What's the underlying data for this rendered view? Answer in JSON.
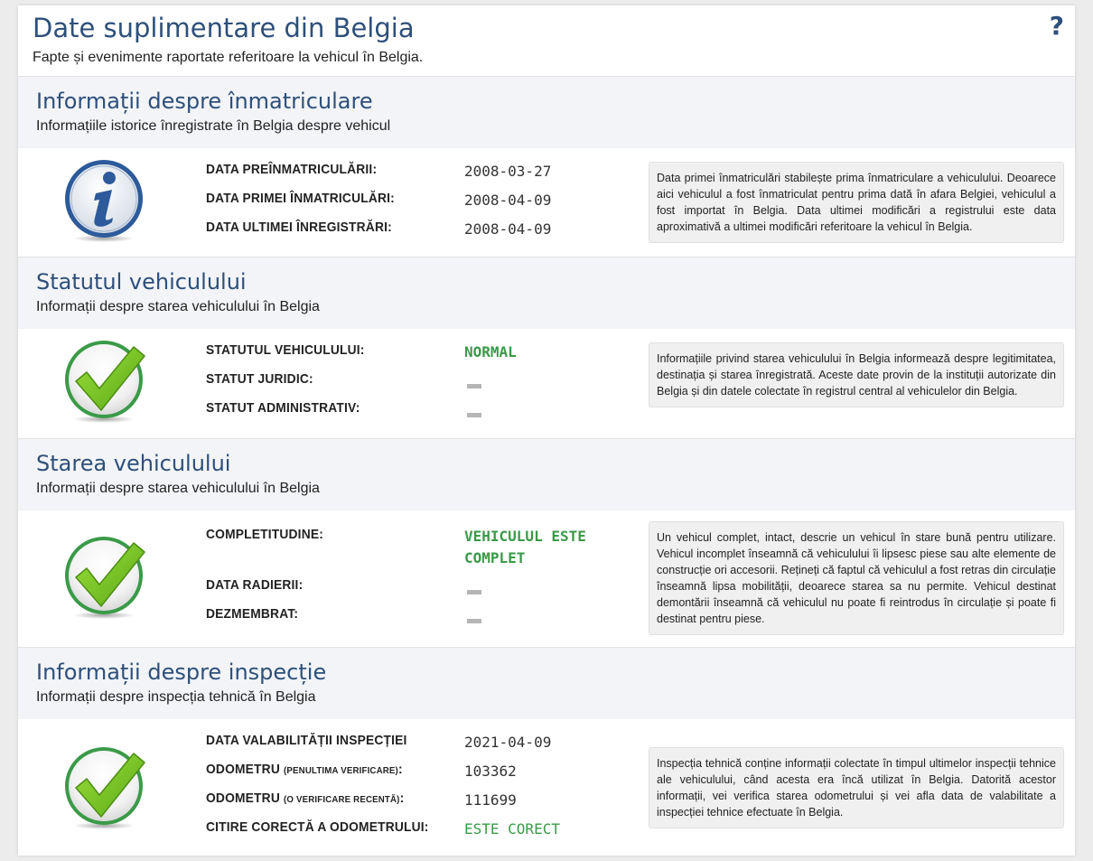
{
  "page": {
    "title": "Date suplimentare din Belgia",
    "subtitle": "Fapte și evenimente raportate referitoare la vehicul în Belgia.",
    "help_icon": "question-mark-icon",
    "help_label": "?"
  },
  "sections": {
    "registration": {
      "title": "Informații despre înmatriculare",
      "subtitle": "Informațiile istorice înregistrate în Belgia despre vehicul",
      "icon": "info-icon",
      "rows": [
        {
          "label": "DATA PREÎNMATRICULĂRII:",
          "value": "2008-03-27"
        },
        {
          "label": "DATA PRIMEI ÎNMATRICULĂRI:",
          "value": "2008-04-09"
        },
        {
          "label": "DATA ULTIMEI ÎNREGISTRĂRI:",
          "value": "2008-04-09"
        }
      ],
      "note": "Data primei înmatriculări stabilește prima înmatriculare a vehiculului. Deoarece aici vehiculul a fost înmatriculat pentru prima dată în afara Belgiei, vehiculul a fost importat în Belgia. Data ultimei modificări a registrului este data aproximativă a ultimei modificări referitoare la vehicul în Belgia."
    },
    "status": {
      "title": "Statutul vehiculului",
      "subtitle": "Informații despre starea vehiculului în Belgia",
      "icon": "checkmark-icon",
      "rows": [
        {
          "label": "STATUTUL VEHICULULUI:",
          "value": "NORMAL"
        },
        {
          "label": "STATUT JURIDIC:",
          "value": ""
        },
        {
          "label": "STATUT ADMINISTRATIV:",
          "value": ""
        }
      ],
      "note": "Informațiile privind starea vehiculului în Belgia informează despre legitimitatea, destinația și starea înregistrată. Aceste date provin de la instituții autorizate din Belgia și din datele colectate în registrul central al vehiculelor din Belgia."
    },
    "condition": {
      "title": "Starea vehiculului",
      "subtitle": "Informații despre starea vehiculului în Belgia",
      "icon": "checkmark-icon",
      "rows": [
        {
          "label": "COMPLETITUDINE:",
          "value_line1": "VEHICULUL ESTE",
          "value_line2": "COMPLET"
        },
        {
          "label": "DATA RADIERII:",
          "value": ""
        },
        {
          "label": "DEZMEMBRAT:",
          "value": ""
        }
      ],
      "note": "Un vehicul complet, intact, descrie un vehicul în stare bună pentru utilizare. Vehicul incomplet înseamnă că vehiculului îi lipsesc piese sau alte elemente de construcție ori accesorii. Rețineți că faptul că vehiculul a fost retras din circulație înseamnă lipsa mobilității, deoarece starea sa nu permite. Vehicul destinat demontării înseamnă că vehiculul nu poate fi reintrodus în circulație și poate fi destinat pentru piese."
    },
    "inspection": {
      "title": "Informații despre inspecție",
      "subtitle": "Informații despre inspecția tehnică în Belgia",
      "icon": "checkmark-icon",
      "rows": [
        {
          "label": "DATA VALABILITĂȚII INSPECȚIEI",
          "value": "2021-04-09"
        },
        {
          "label": "ODOMETRU",
          "label_small": "(PENULTIMA VERIFICARE)",
          "label_end": ":",
          "value": "103362"
        },
        {
          "label": "ODOMETRU",
          "label_small": "(O VERIFICARE RECENTĂ)",
          "label_end": ":",
          "value": "111699"
        },
        {
          "label": "CITIRE CORECTĂ A ODOMETRULUI:",
          "value": "ESTE CORECT"
        }
      ],
      "note": "Inspecția tehnică conține informații colectate în timpul ultimelor inspecții tehnice ale vehiculului, când acesta era încă utilizat în Belgia. Datorită acestor informații, vei verifica starea odometrului și vei afla data de valabilitate a inspecției tehnice efectuate în Belgia."
    }
  },
  "colors": {
    "heading": "#2e4f7a",
    "status_ok": "#3a9a48",
    "section_bg": "#f2f4f7",
    "note_bg": "#f0f0f0"
  }
}
